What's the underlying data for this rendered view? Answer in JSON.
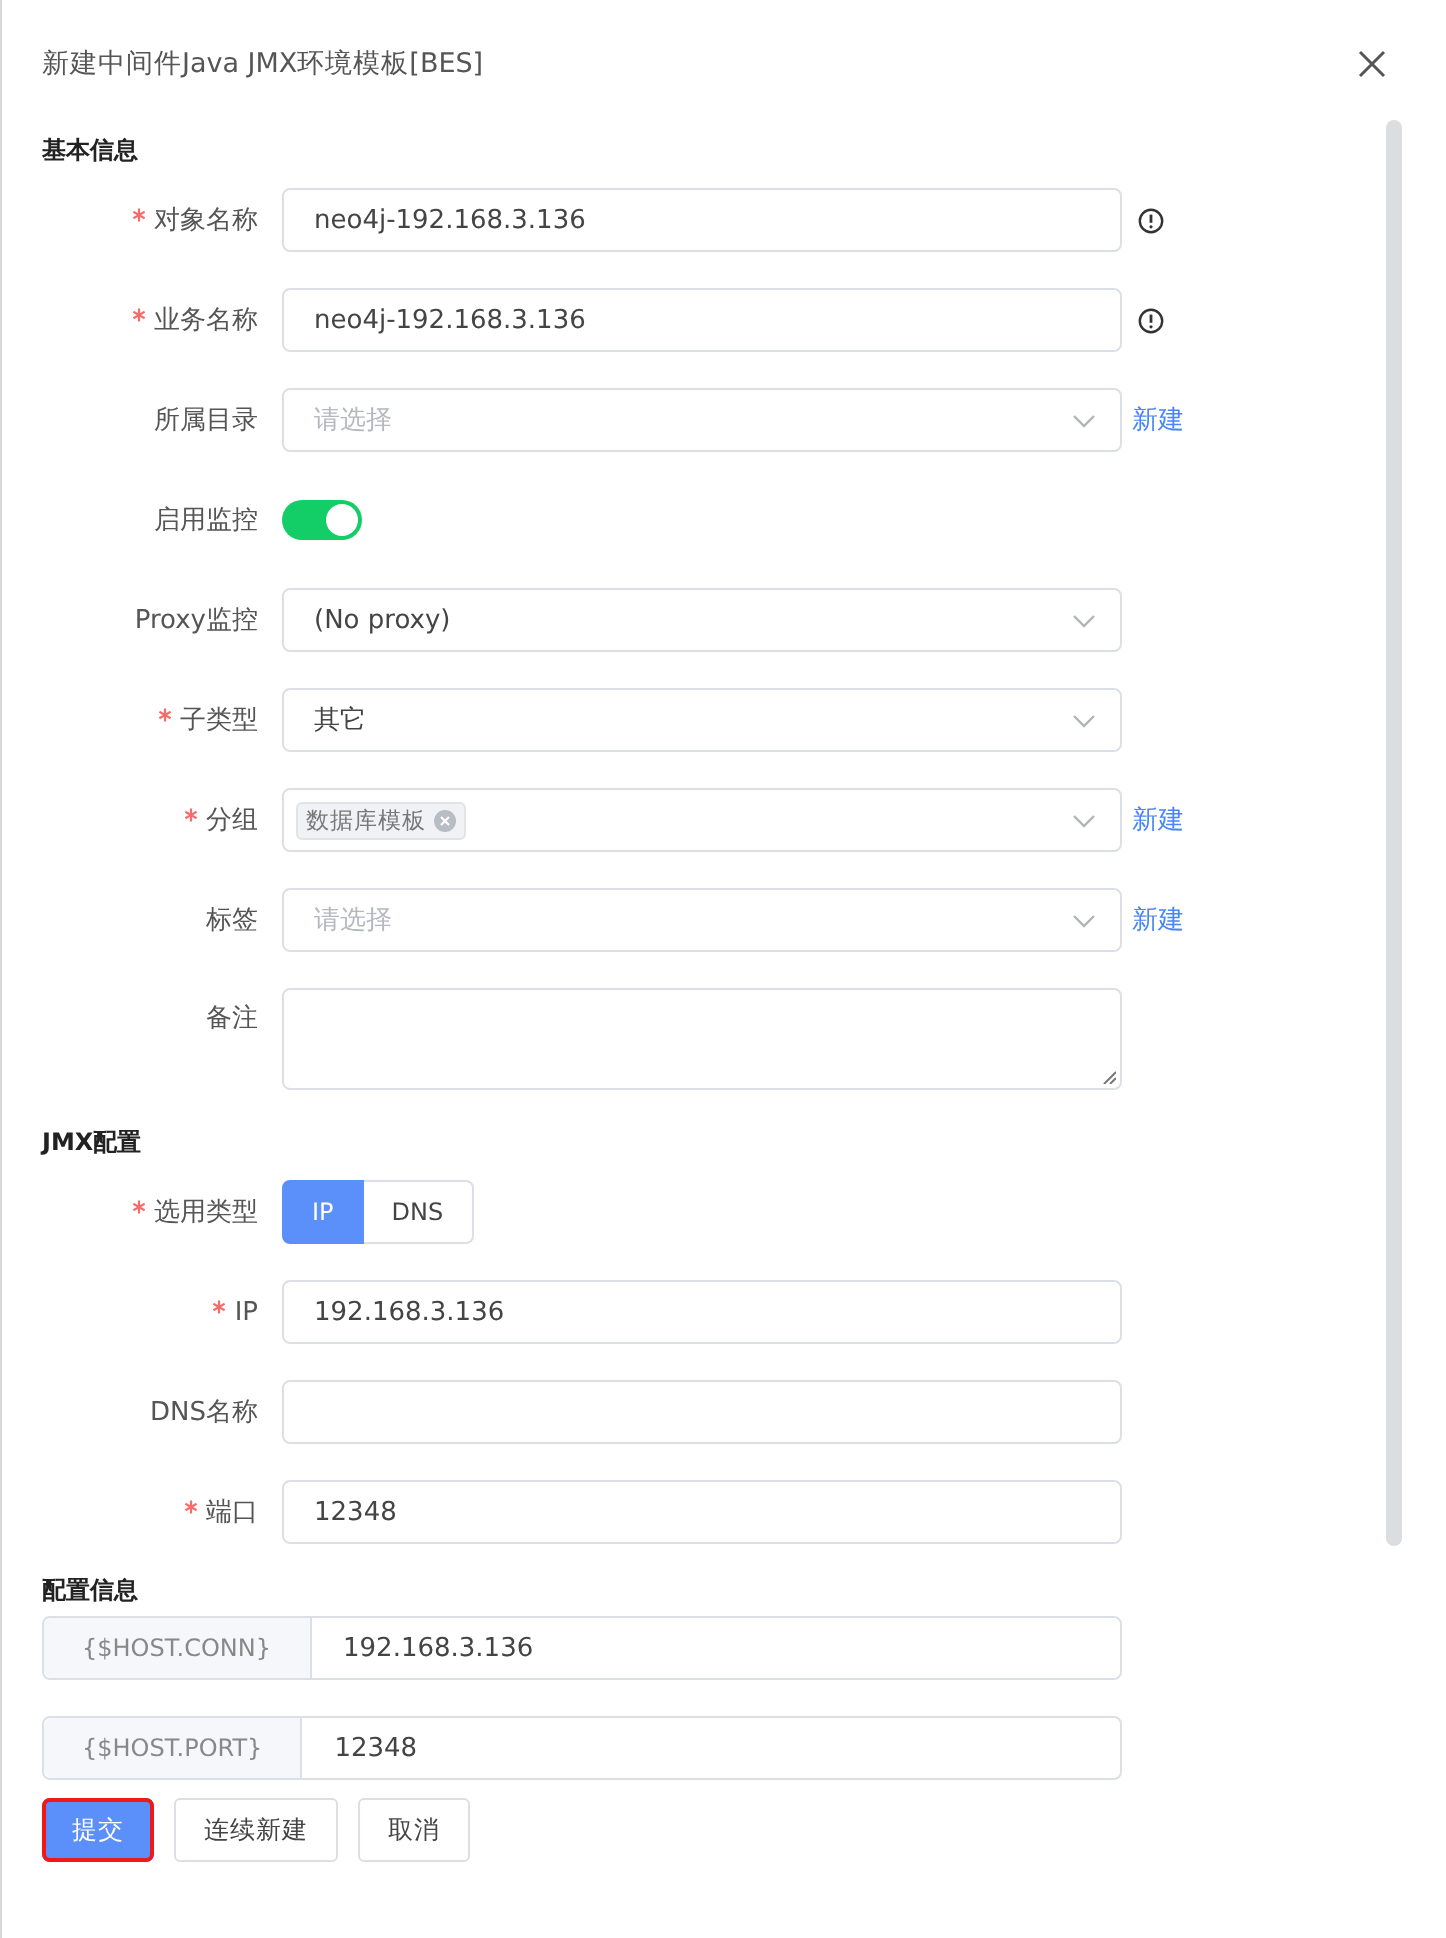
{
  "dialog": {
    "title": "新建中间件Java JMX环境模板[BES]"
  },
  "sections": [
    {
      "title": "基本信息",
      "fields": [
        {
          "kind": "input",
          "label": "对象名称",
          "required": true,
          "value": "neo4j-192.168.3.136",
          "info": true
        },
        {
          "kind": "input",
          "label": "业务名称",
          "required": true,
          "value": "neo4j-192.168.3.136",
          "info": true
        },
        {
          "kind": "select",
          "label": "所属目录",
          "required": false,
          "placeholder": "请选择",
          "link": "新建"
        },
        {
          "kind": "switch",
          "label": "启用监控",
          "required": false,
          "on": true
        },
        {
          "kind": "select",
          "label": "Proxy监控",
          "required": false,
          "value": "(No proxy)"
        },
        {
          "kind": "select",
          "label": "子类型",
          "required": true,
          "value": "其它"
        },
        {
          "kind": "select",
          "label": "分组",
          "required": true,
          "tags": [
            "数据库模板"
          ],
          "link": "新建"
        },
        {
          "kind": "select",
          "label": "标签",
          "required": false,
          "placeholder": "请选择",
          "link": "新建"
        },
        {
          "kind": "textarea",
          "label": "备注",
          "required": false
        }
      ]
    },
    {
      "title": "JMX配置",
      "fields": [
        {
          "kind": "segmented",
          "label": "选用类型",
          "required": true,
          "options": [
            {
              "label": "IP",
              "selected": true
            },
            {
              "label": "DNS",
              "selected": false
            }
          ]
        },
        {
          "kind": "input",
          "label": "IP",
          "required": true,
          "value": "192.168.3.136"
        },
        {
          "kind": "input",
          "label": "DNS名称",
          "required": false
        },
        {
          "kind": "input",
          "label": "端口",
          "required": true,
          "value": "12348"
        }
      ]
    }
  ],
  "config": {
    "title": "配置信息",
    "rows": [
      {
        "prefix": "{$HOST.CONN}",
        "value": "192.168.3.136"
      },
      {
        "prefix": "{$HOST.PORT}",
        "value": "12348"
      }
    ]
  },
  "buttons": [
    {
      "label": "提交",
      "kind": "primary",
      "highlighted": true
    },
    {
      "label": "连续新建",
      "kind": "default",
      "highlighted": false
    },
    {
      "label": "取消",
      "kind": "default",
      "highlighted": false
    }
  ]
}
